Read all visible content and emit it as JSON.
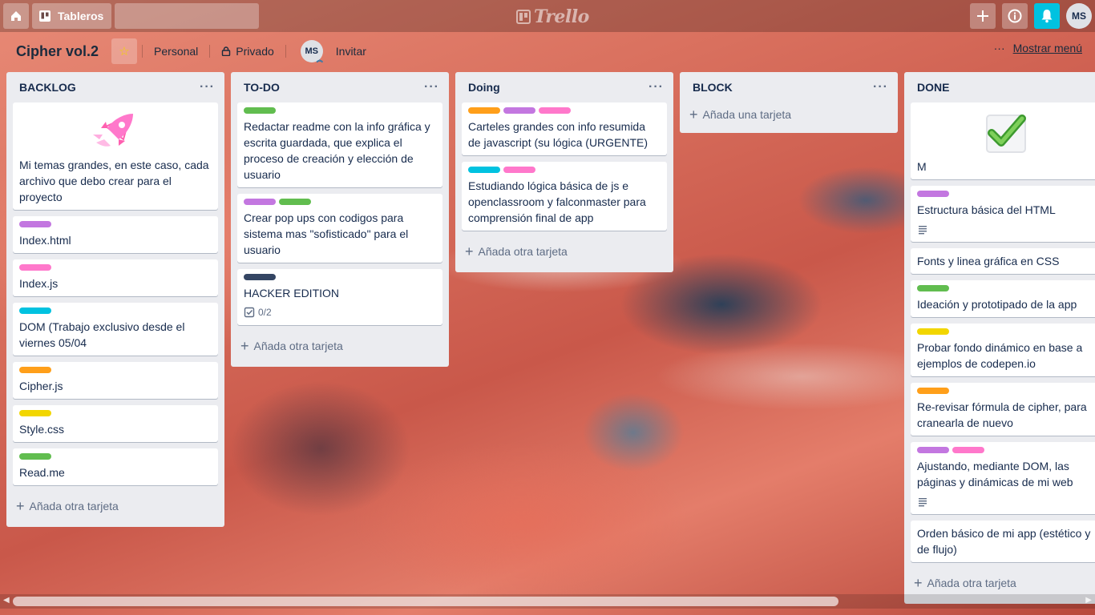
{
  "header": {
    "boards_label": "Tableros",
    "search_placeholder": "",
    "logo_text": "Trello",
    "user_initials": "MS"
  },
  "board": {
    "title": "Cipher vol.2",
    "team": "Personal",
    "visibility": "Privado",
    "member_initials": "MS",
    "invite_label": "Invitar",
    "menu_dots": "···",
    "menu_label": "Mostrar menú"
  },
  "colors": {
    "green": "#61bd4f",
    "purple": "#c377e0",
    "pink": "#ff78cb",
    "sky": "#00c2e0",
    "orange": "#ff9f1a",
    "yellow": "#f2d600",
    "black": "#344563",
    "bell": "#00c2e0"
  },
  "lists": [
    {
      "title": "BACKLOG",
      "dots": "···",
      "add_label": "Añada otra tarjeta",
      "cards": [
        {
          "cover": "rocket-sticker",
          "labels": [],
          "text": "Mi temas grandes, en este caso, cada archivo que debo crear para el proyecto"
        },
        {
          "labels": [
            "purple"
          ],
          "text": "Index.html"
        },
        {
          "labels": [
            "pink"
          ],
          "text": "Index.js"
        },
        {
          "labels": [
            "sky"
          ],
          "text": "DOM (Trabajo exclusivo desde el viernes 05/04"
        },
        {
          "labels": [
            "orange"
          ],
          "text": "Cipher.js"
        },
        {
          "labels": [
            "yellow"
          ],
          "text": "Style.css"
        },
        {
          "labels": [
            "green"
          ],
          "text": "Read.me"
        }
      ]
    },
    {
      "title": "TO-DO",
      "dots": "···",
      "add_label": "Añada otra tarjeta",
      "cards": [
        {
          "labels": [
            "green"
          ],
          "text": "Redactar readme con la info gráfica y escrita guardada, que explica el proceso de creación y elección de usuario"
        },
        {
          "labels": [
            "purple",
            "green"
          ],
          "text": "Crear pop ups con codigos para sistema mas \"sofisticado\" para el usuario"
        },
        {
          "labels": [
            "black"
          ],
          "text": "HACKER EDITION",
          "checklist": "0/2"
        }
      ]
    },
    {
      "title": "Doing",
      "dots": "···",
      "add_label": "Añada otra tarjeta",
      "cards": [
        {
          "labels": [
            "orange",
            "purple",
            "pink"
          ],
          "text": "Carteles grandes con info resumida de javascript (su lógica (URGENTE)"
        },
        {
          "labels": [
            "sky",
            "pink"
          ],
          "text": "Estudiando lógica básica de js e openclassroom y falconmaster para comprensión final de app"
        }
      ]
    },
    {
      "title": "BLOCK",
      "dots": "···",
      "add_label": "Añada una tarjeta",
      "cards": []
    },
    {
      "title": "DONE",
      "dots": "···",
      "add_label": "Añada otra tarjeta",
      "cards": [
        {
          "cover": "checkmark-sticker",
          "labels": [],
          "text": "M"
        },
        {
          "labels": [
            "purple"
          ],
          "text": "Estructura básica del HTML",
          "description": true
        },
        {
          "labels": [],
          "text": "Fonts y linea gráfica en CSS"
        },
        {
          "labels": [
            "green"
          ],
          "text": "Ideación y prototipado de la app"
        },
        {
          "labels": [
            "yellow"
          ],
          "text": "Probar fondo dinámico en base a ejemplos de codepen.io"
        },
        {
          "labels": [
            "orange"
          ],
          "text": "Re-revisar fórmula de cipher, para cranearla de nuevo"
        },
        {
          "labels": [
            "purple",
            "pink"
          ],
          "text": "Ajustando, mediante DOM, las páginas y dinámicas de mi web",
          "description": true
        },
        {
          "labels": [],
          "text": "Orden básico de mi app (estético y de flujo)"
        }
      ]
    }
  ]
}
